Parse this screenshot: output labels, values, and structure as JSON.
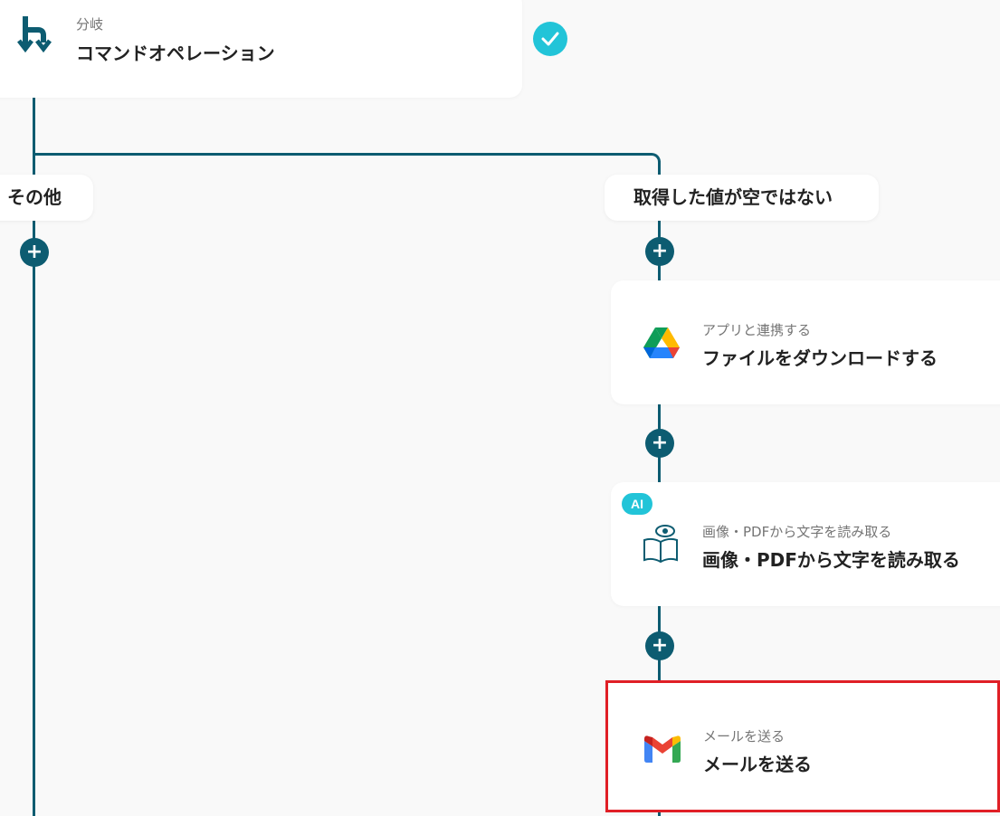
{
  "branch_step": {
    "type_label": "分岐",
    "title": "コマンドオペレーション",
    "icon": "branch-icon",
    "status": "completed"
  },
  "branches": {
    "other_label": "その他",
    "not_empty_label": "取得した値が空ではない"
  },
  "steps": [
    {
      "sub": "アプリと連携する",
      "title": "ファイルをダウンロードする",
      "icon": "google-drive-icon"
    },
    {
      "badge": "AI",
      "sub": "画像・PDFから文字を読み取る",
      "title": "画像・PDFから文字を読み取る",
      "icon": "ocr-book-eye-icon"
    },
    {
      "sub": "メールを送る",
      "title": "メールを送る",
      "icon": "gmail-icon",
      "highlighted": true
    }
  ],
  "colors": {
    "connector": "#0d5c71",
    "check": "#22c4d8",
    "highlight_border": "#e01f26",
    "background": "#f9f9f9"
  },
  "plus_symbol": "+"
}
